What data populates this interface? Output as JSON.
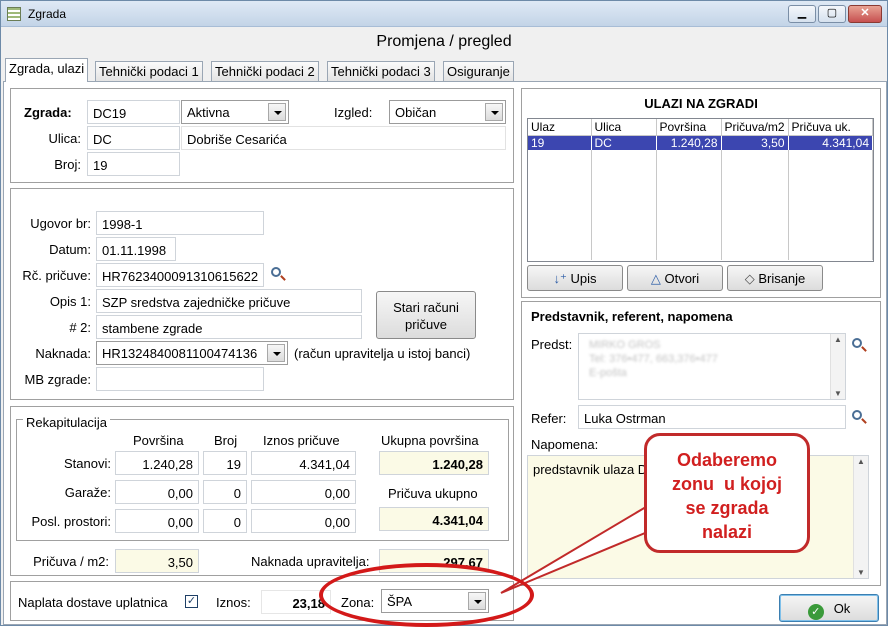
{
  "window": {
    "title": "Zgrada",
    "heading": "Promjena / pregled"
  },
  "tabs": [
    "Zgrada, ulazi",
    "Tehnički podaci 1",
    "Tehnički podaci 2",
    "Tehnički podaci 3",
    "Osiguranje"
  ],
  "zgrada": {
    "label": "Zgrada:",
    "code": "DC19",
    "status": "Aktivna",
    "izgled_label": "Izgled:",
    "izgled": "Običan",
    "ulica_label": "Ulica:",
    "ulica_code": "DC",
    "ulica_name": "Dobriše Cesarića",
    "broj_label": "Broj:",
    "broj": "19"
  },
  "ugovor": {
    "ugovor_label": "Ugovor br:",
    "ugovor": "1998-1",
    "datum_label": "Datum:",
    "datum": "01.11.1998",
    "racun_label": "Rč. pričuve:",
    "racun": "HR7623400091310615622",
    "opis1_label": "Opis 1:",
    "opis1": "SZP sredstva zajedničke pričuve",
    "opis2_label": "# 2:",
    "opis2": "stambene zgrade",
    "stari_button": "Stari računi pričuve",
    "naknada_label": "Naknada:",
    "naknada": "HR1324840081100474136",
    "naknada_note": "(račun upravitelja u istoj banci)",
    "mb_label": "MB zgrade:",
    "mb": ""
  },
  "rekap": {
    "title": "Rekapitulacija",
    "headers": [
      "Površina",
      "Broj",
      "Iznos pričuve"
    ],
    "rows": [
      {
        "label": "Stanovi:",
        "povrsina": "1.240,28",
        "broj": "19",
        "iznos": "4.341,04"
      },
      {
        "label": "Garaže:",
        "povrsina": "0,00",
        "broj": "0",
        "iznos": "0,00"
      },
      {
        "label": "Posl. prostori:",
        "povrsina": "0,00",
        "broj": "0",
        "iznos": "0,00"
      }
    ],
    "ukupna_label": "Ukupna površina",
    "ukupna": "1.240,28",
    "pricuva_ukupno_label": "Pričuva ukupno",
    "pricuva_ukupno": "4.341,04"
  },
  "pricuva_m2_label": "Pričuva / m2:",
  "pricuva_m2": "3,50",
  "naknada_upr_label": "Naknada upravitelja:",
  "naknada_upr": "297,67",
  "naplata": {
    "label": "Naplata dostave uplatnica",
    "checked": true,
    "iznos_label": "Iznos:",
    "iznos": "23,18",
    "zona_label": "Zona:",
    "zona": "ŠPA"
  },
  "ulazi": {
    "title": "ULAZI NA ZGRADI",
    "columns": [
      "Ulaz",
      "Ulica",
      "Površina",
      "Pričuva/m2",
      "Pričuva uk."
    ],
    "rows": [
      [
        "19",
        "DC",
        "1.240,28",
        "3,50",
        "4.341,04"
      ]
    ],
    "buttons": {
      "upis": "Upis",
      "otvori": "Otvori",
      "brisanje": "Brisanje"
    }
  },
  "predstavnik": {
    "title": "Predstavnik, referent, napomena",
    "predst_label": "Predst:",
    "predst_lines": [
      "MIRKO GROS",
      "Tel: 376•477, 663,376•477",
      "E-pošta"
    ],
    "refer_label": "Refer:",
    "refer": "Luka Ostrman",
    "napomena_label": "Napomena:",
    "napomena": "predstavnik ulaza D"
  },
  "callout": {
    "text": [
      "Odaberemo",
      "zonu  u kojoj",
      "se zgrada",
      "nalazi"
    ]
  },
  "ok_button": "Ok"
}
